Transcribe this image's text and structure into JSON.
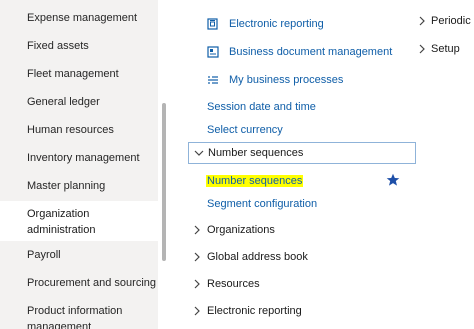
{
  "sidebar": {
    "items": [
      {
        "label": "Expense management"
      },
      {
        "label": "Fixed assets"
      },
      {
        "label": "Fleet management"
      },
      {
        "label": "General ledger"
      },
      {
        "label": "Human resources"
      },
      {
        "label": "Inventory management"
      },
      {
        "label": "Master planning"
      },
      {
        "label_line1": "Organization",
        "label_line2": "administration"
      },
      {
        "label": "Payroll"
      },
      {
        "label": "Procurement and sourcing"
      },
      {
        "label_line1": "Product information",
        "label_line2": "management"
      }
    ]
  },
  "links": {
    "electronic_reporting": "Electronic reporting",
    "business_document_management": "Business document management",
    "my_business_processes": "My business processes",
    "session_date_time": "Session date and time",
    "select_currency": "Select currency"
  },
  "groups": {
    "number_sequences": {
      "label": "Number sequences",
      "items": {
        "number_sequences": "Number sequences",
        "segment_configuration": "Segment configuration"
      }
    },
    "organizations": "Organizations",
    "global_address_book": "Global address book",
    "resources": "Resources",
    "electronic_reporting": "Electronic reporting"
  },
  "right": {
    "periodic": "Periodic",
    "setup": "Setup"
  },
  "colors": {
    "link": "#0f5ea8",
    "highlight": "#ffff00",
    "favorite_star": "#1e4fa8"
  },
  "icons": [
    "electronic-reporting-icon",
    "business-document-icon",
    "business-process-icon",
    "chevron-down-icon",
    "chevron-right-icon",
    "favorite-star-icon"
  ]
}
